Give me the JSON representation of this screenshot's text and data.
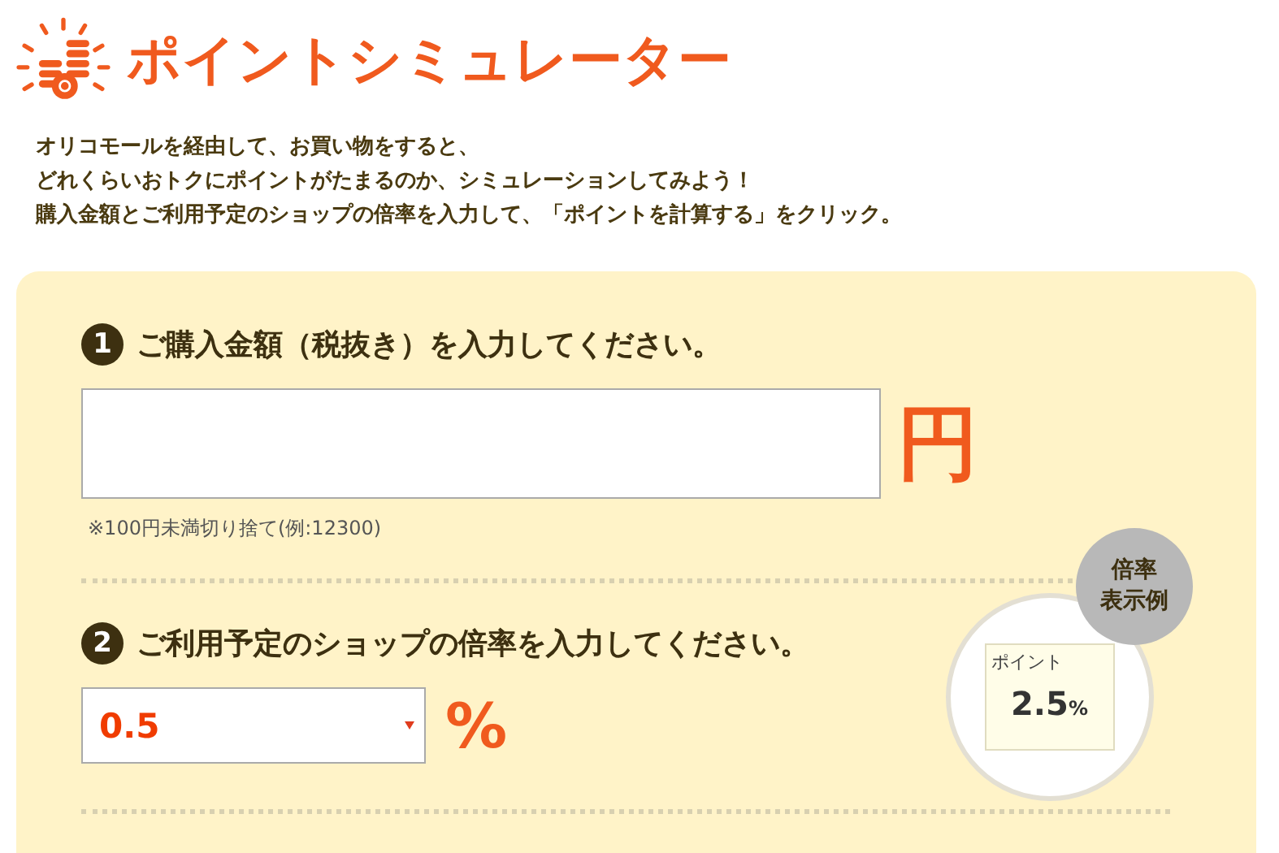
{
  "header": {
    "title": "ポイントシミュレーター"
  },
  "intro": [
    "オリコモールを経由して、お買い物をすると、",
    "どれくらいおトクにポイントがたまるのか、シミュレーションしてみよう！",
    "購入金額とご利用予定のショップの倍率を入力して、「ポイントを計算する」をクリック。"
  ],
  "step1": {
    "number": "1",
    "heading": "ご購入金額（税抜き）を入力してください。",
    "unit": "円",
    "note": "※100円未満切り捨て(例:12300)"
  },
  "step2": {
    "number": "2",
    "heading": "ご利用予定のショップの倍率を入力してください。",
    "value": "0.5",
    "unit": "%"
  },
  "example": {
    "badge": [
      "倍率",
      "表示例"
    ],
    "label": "ポイント",
    "rate": "2.5",
    "unit": "%"
  }
}
